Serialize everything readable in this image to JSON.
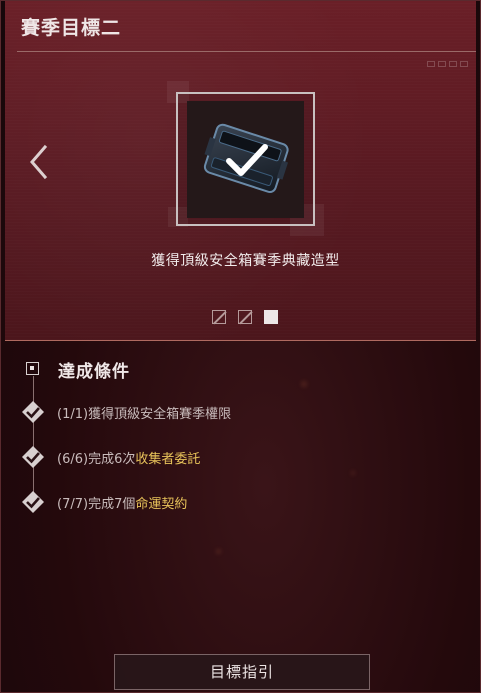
{
  "panel": {
    "title": "賽季目標二"
  },
  "reward": {
    "caption": "獲得頂級安全箱賽季典藏造型",
    "claimed": true,
    "pager_count": 3,
    "pager_active_index": 2
  },
  "conditions": {
    "header": "達成條件",
    "items": [
      {
        "progress": "(1/1)",
        "prefix": "獲得頂級安全箱賽季權限",
        "highlight": "",
        "completed": true
      },
      {
        "progress": "(6/6)",
        "prefix": "完成6次",
        "highlight": "收集者委託",
        "completed": true
      },
      {
        "progress": "(7/7)",
        "prefix": "完成7個",
        "highlight": "命運契約",
        "completed": true
      }
    ]
  },
  "footer": {
    "guide_button_label": "目標指引"
  },
  "colors": {
    "panel_bg": "#5a1a22",
    "highlight": "#e8c35a",
    "text_dim": "#c9bcbc"
  }
}
